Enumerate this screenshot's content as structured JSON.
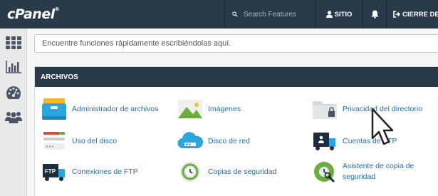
{
  "header": {
    "logo": "cPanel",
    "logo_mark": "®",
    "search_placeholder": "Search Features",
    "user_label": "SITIO",
    "logout_label": "CIERRE DE S"
  },
  "function_search": {
    "placeholder": "Encuentre funciones rápidamente escribiéndolas aquí."
  },
  "panel": {
    "title": "ARCHIVOS",
    "items": [
      {
        "label": "Administrador de archivos",
        "icon": "file-manager-icon"
      },
      {
        "label": "Imágenes",
        "icon": "images-icon"
      },
      {
        "label": "Privacidad del directorio",
        "icon": "directory-privacy-icon"
      },
      {
        "label": "Uso del disco",
        "icon": "disk-usage-icon"
      },
      {
        "label": "Disco de red",
        "icon": "network-disk-icon"
      },
      {
        "label": "Cuentas de FTP",
        "icon": "ftp-accounts-icon"
      },
      {
        "label": "Conexiones de FTP",
        "icon": "ftp-connections-icon"
      },
      {
        "label": "Copias de seguridad",
        "icon": "backup-icon"
      },
      {
        "label": "Asistente de copia de seguridad",
        "icon": "backup-wizard-icon"
      }
    ]
  },
  "icons": {
    "sidebar": [
      "grid-icon",
      "stats-icon",
      "dashboard-icon",
      "users-icon"
    ],
    "accent": "#293a4a",
    "link_color": "#1f6fb3"
  }
}
